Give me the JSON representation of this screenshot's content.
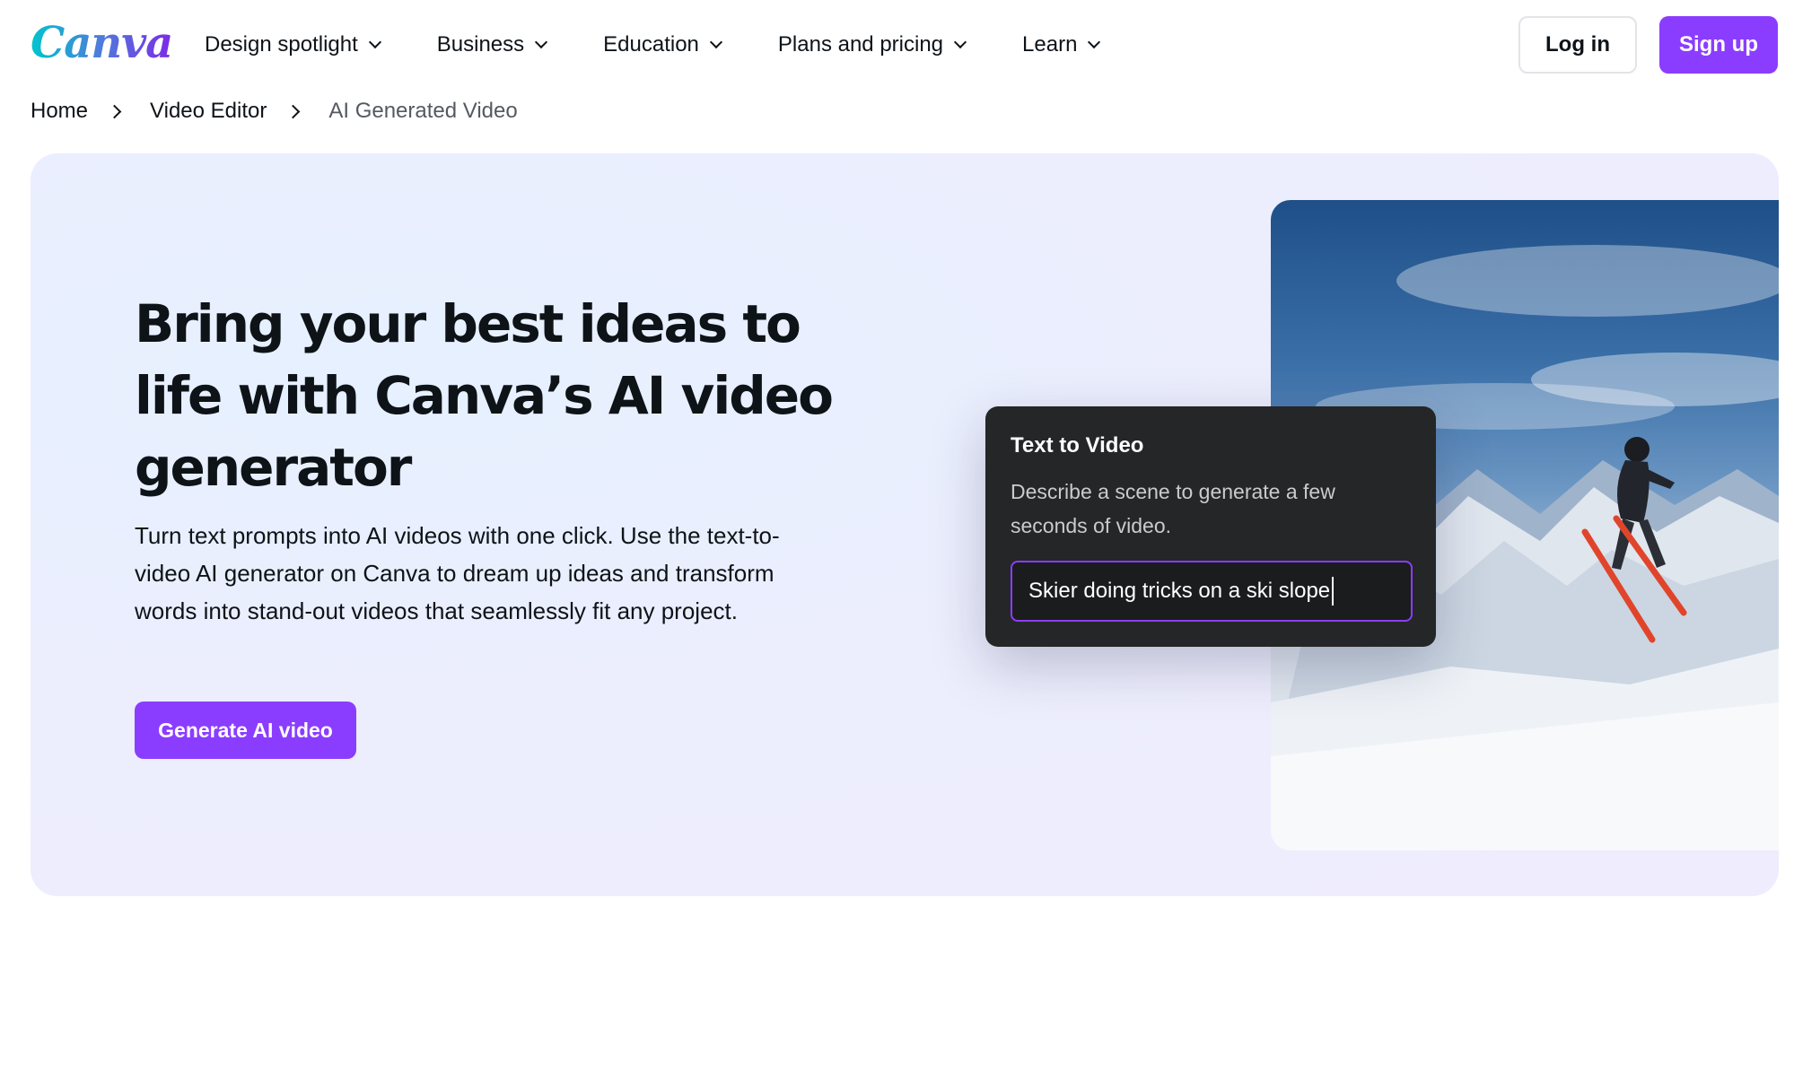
{
  "header": {
    "logo": "Canva",
    "nav": [
      {
        "label": "Design spotlight"
      },
      {
        "label": "Business"
      },
      {
        "label": "Education"
      },
      {
        "label": "Plans and pricing"
      },
      {
        "label": "Learn"
      }
    ],
    "login_label": "Log in",
    "signup_label": "Sign up"
  },
  "breadcrumb": {
    "items": [
      "Home",
      "Video Editor",
      "AI Generated Video"
    ]
  },
  "hero": {
    "title": "Bring your best ideas to life with Canva’s AI video generator",
    "description": "Turn text prompts into AI videos with one click. Use the text-to-video AI generator on Canva to dream up ideas and transform words into stand-out videos that seamlessly fit any project.",
    "cta_label": "Generate AI video"
  },
  "text_to_video": {
    "title": "Text to Video",
    "description": "Describe a scene to generate a few seconds of video.",
    "input_value": "Skier doing tricks on a ski slope"
  },
  "colors": {
    "brand_purple": "#8b3dff",
    "card_dark": "#252627"
  }
}
